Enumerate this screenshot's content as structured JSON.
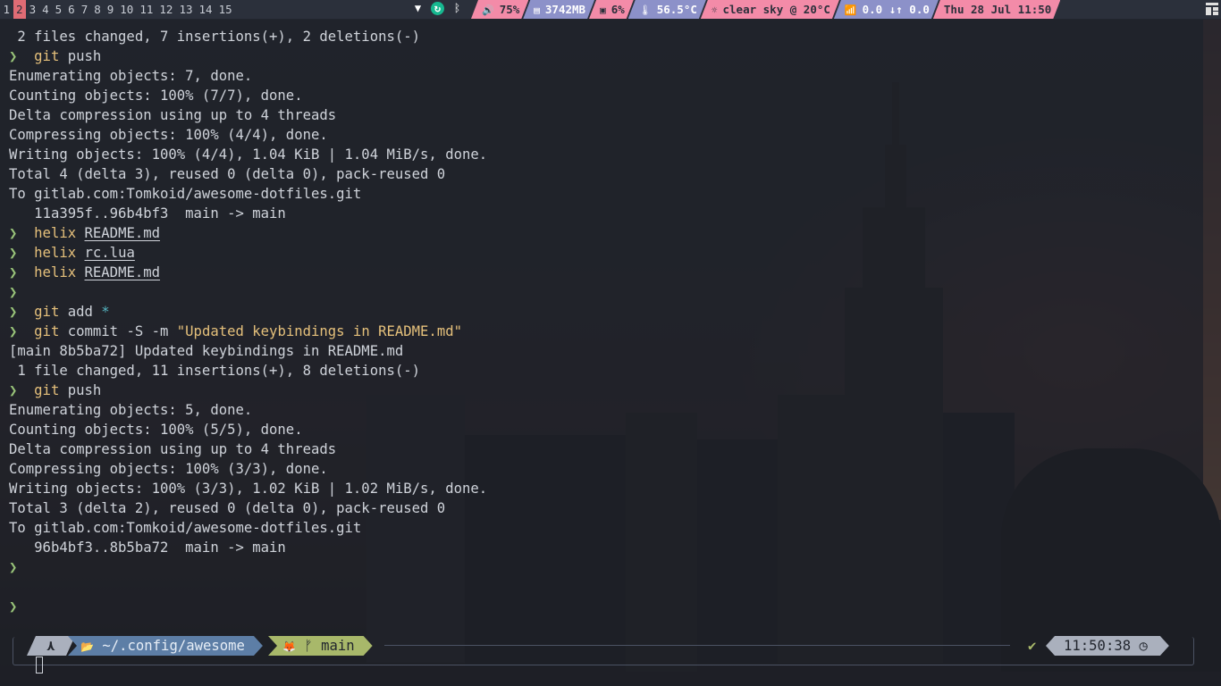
{
  "topbar": {
    "tags": [
      "1",
      "2",
      "3",
      "4",
      "5",
      "6",
      "7",
      "8",
      "9",
      "10",
      "11",
      "12",
      "13",
      "14",
      "15"
    ],
    "active_tag": "2",
    "tray_icons": [
      "wifi-icon",
      "sync-icon",
      "bluetooth-icon"
    ],
    "widgets": [
      {
        "icon": "volume-icon",
        "glyph": "🔊",
        "value": "75%",
        "style": "pink"
      },
      {
        "icon": "memory-icon",
        "glyph": "▤",
        "value": "3742MB",
        "style": "purple"
      },
      {
        "icon": "cpu-icon",
        "glyph": "▣",
        "value": "6%",
        "style": "pink"
      },
      {
        "icon": "temperature-icon",
        "glyph": "🌡",
        "value": "56.5°C",
        "style": "purple"
      },
      {
        "icon": "weather-icon",
        "glyph": "☼",
        "value": "clear sky @ 20°C",
        "style": "pink"
      },
      {
        "icon": "network-icon",
        "glyph": "📶",
        "value": "0.0 ↓↑ 0.0",
        "style": "purple"
      },
      {
        "icon": "clock-icon",
        "glyph": "",
        "value": "Thu 28 Jul 11:50",
        "style": "pink"
      }
    ]
  },
  "terminal": {
    "lines": [
      {
        "type": "out",
        "text": " 2 files changed, 7 insertions(+), 2 deletions(-)"
      },
      {
        "type": "cmd",
        "cmd": "git",
        "args": " push"
      },
      {
        "type": "out",
        "text": "Enumerating objects: 7, done."
      },
      {
        "type": "out",
        "text": "Counting objects: 100% (7/7), done."
      },
      {
        "type": "out",
        "text": "Delta compression using up to 4 threads"
      },
      {
        "type": "out",
        "text": "Compressing objects: 100% (4/4), done."
      },
      {
        "type": "out",
        "text": "Writing objects: 100% (4/4), 1.04 KiB | 1.04 MiB/s, done."
      },
      {
        "type": "out",
        "text": "Total 4 (delta 3), reused 0 (delta 0), pack-reused 0"
      },
      {
        "type": "out",
        "text": "To gitlab.com:Tomkoid/awesome-dotfiles.git"
      },
      {
        "type": "out",
        "text": "   11a395f..96b4bf3  main -> main"
      },
      {
        "type": "cmdfile",
        "cmd": "helix",
        "file": "README.md"
      },
      {
        "type": "cmdfile",
        "cmd": "helix",
        "file": "rc.lua"
      },
      {
        "type": "cmdfile",
        "cmd": "helix",
        "file": "README.md"
      },
      {
        "type": "prompt"
      },
      {
        "type": "cmdglob",
        "cmd": "git",
        "args": " add ",
        "glob": "*"
      },
      {
        "type": "cmdstr",
        "cmd": "git",
        "args": " commit -S -m ",
        "str": "\"Updated keybindings in README.md\""
      },
      {
        "type": "out",
        "text": "[main 8b5ba72] Updated keybindings in README.md"
      },
      {
        "type": "out",
        "text": " 1 file changed, 11 insertions(+), 8 deletions(-)"
      },
      {
        "type": "cmd",
        "cmd": "git",
        "args": " push"
      },
      {
        "type": "out",
        "text": "Enumerating objects: 5, done."
      },
      {
        "type": "out",
        "text": "Counting objects: 100% (5/5), done."
      },
      {
        "type": "out",
        "text": "Delta compression using up to 4 threads"
      },
      {
        "type": "out",
        "text": "Compressing objects: 100% (3/3), done."
      },
      {
        "type": "out",
        "text": "Writing objects: 100% (3/3), 1.02 KiB | 1.02 MiB/s, done."
      },
      {
        "type": "out",
        "text": "Total 3 (delta 2), reused 0 (delta 0), pack-reused 0"
      },
      {
        "type": "out",
        "text": "To gitlab.com:Tomkoid/awesome-dotfiles.git"
      },
      {
        "type": "out",
        "text": "   96b4bf3..8b5ba72  main -> main"
      },
      {
        "type": "prompt"
      },
      {
        "type": "blank"
      },
      {
        "type": "prompt"
      }
    ],
    "prompt_symbol": "❯"
  },
  "prompt": {
    "os_glyph": "⋏",
    "dir_glyph": "📂",
    "dir": "~/.config/awesome",
    "git_glyph": "🦊",
    "branch_glyph": "ᚠ",
    "branch": "main",
    "status_glyph": "✔",
    "time": "11:50:38",
    "time_glyph": "◷"
  }
}
